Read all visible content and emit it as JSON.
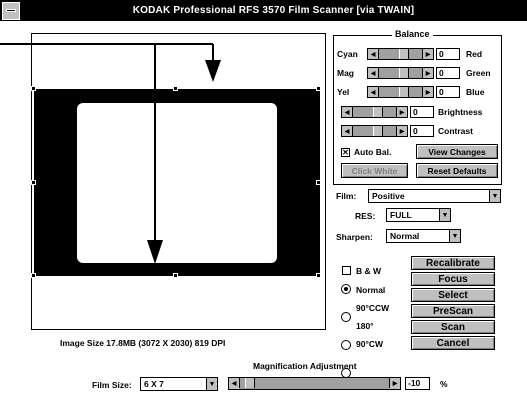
{
  "window": {
    "title": "KODAK Professional RFS 3570 Film Scanner [via TWAIN]"
  },
  "preview": {
    "image_info": "Image Size  17.8MB (3072 X 2030) 819 DPI"
  },
  "balance": {
    "title": "Balance",
    "rows": [
      {
        "left": "Cyan",
        "value": "0",
        "right": "Red"
      },
      {
        "left": "Mag",
        "value": "0",
        "right": "Green"
      },
      {
        "left": "Yel",
        "value": "0",
        "right": "Blue"
      },
      {
        "left": "",
        "value": "0",
        "right": "Brightness"
      },
      {
        "left": "",
        "value": "0",
        "right": "Contrast"
      }
    ],
    "auto_bal_label": "Auto Bal.",
    "auto_bal_checked": true,
    "view_changes": "View Changes",
    "click_white": "Click White",
    "reset_defaults": "Reset Defaults"
  },
  "film": {
    "label": "Film:",
    "value": "Positive"
  },
  "res": {
    "label": "RES:",
    "value": "FULL"
  },
  "sharpen": {
    "label": "Sharpen:",
    "value": "Normal"
  },
  "bw": {
    "label": "B & W",
    "checked": false
  },
  "orientation": {
    "options": [
      "Normal",
      "90°CCW",
      "180°",
      "90°CW"
    ],
    "selected": "Normal"
  },
  "actions": {
    "recalibrate": "Recalibrate",
    "focus": "Focus",
    "select": "Select",
    "prescan": "PreScan",
    "scan": "Scan",
    "cancel": "Cancel"
  },
  "magnification": {
    "title": "Magnification Adjustment",
    "film_size_label": "Film Size:",
    "film_size_value": "6 X 7",
    "value": "-10",
    "unit": "%"
  }
}
